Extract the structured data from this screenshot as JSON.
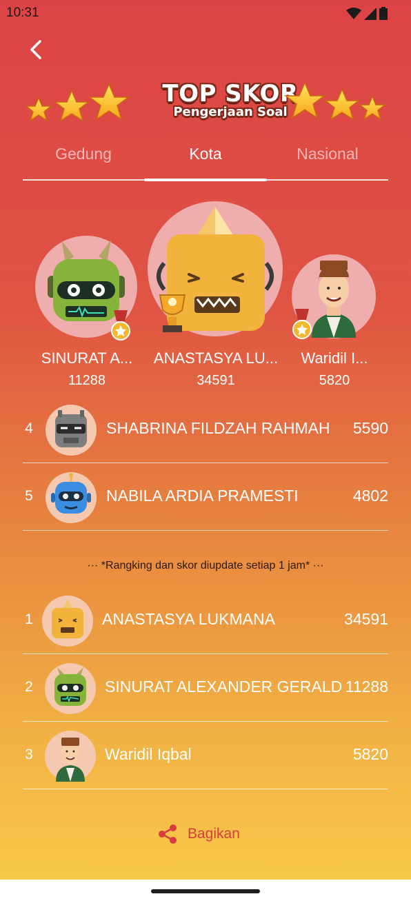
{
  "status_bar": {
    "time": "10:31"
  },
  "header": {
    "title_line1": "TOP SKOR",
    "title_line2": "Pengerjaan Soal"
  },
  "tabs": [
    {
      "label": "Gedung",
      "active": false
    },
    {
      "label": "Kota",
      "active": true
    },
    {
      "label": "Nasional",
      "active": false
    }
  ],
  "podium": [
    {
      "place": 2,
      "name": "SINURAT A...",
      "score": "11288",
      "avatar": "green-robot-avatar"
    },
    {
      "place": 1,
      "name": "ANASTASYA LU...",
      "score": "34591",
      "avatar": "yellow-robot-avatar"
    },
    {
      "place": 3,
      "name": "Waridil I...",
      "score": "5820",
      "avatar": "man-avatar"
    }
  ],
  "ranking": [
    {
      "rank": "4",
      "name": "SHABRINA FILDZAH RAHMAH",
      "score": "5590",
      "avatar": "gray-robot-avatar"
    },
    {
      "rank": "5",
      "name": "NABILA ARDIA PRAMESTI",
      "score": "4802",
      "avatar": "blue-robot-avatar"
    }
  ],
  "note": "··· *Rangking dan skor diupdate setiap 1 jam* ···",
  "top_list": [
    {
      "rank": "1",
      "name": "ANASTASYA LUKMANA",
      "score": "34591",
      "avatar": "yellow-robot-avatar"
    },
    {
      "rank": "2",
      "name": "SINURAT ALEXANDER GERALD",
      "score": "11288",
      "avatar": "green-robot-avatar"
    },
    {
      "rank": "3",
      "name": "Waridil Iqbal",
      "score": "5820",
      "avatar": "man-avatar"
    }
  ],
  "share": {
    "label": "Bagikan"
  },
  "colors": {
    "accent": "#d83d3d",
    "top": "#dc4346",
    "bottom": "#f7c84a"
  }
}
